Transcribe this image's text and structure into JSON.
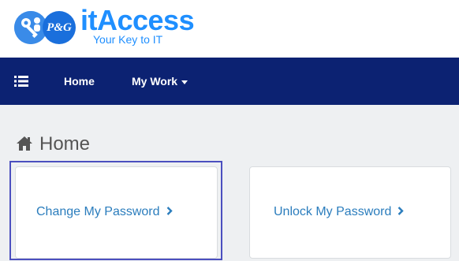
{
  "branding": {
    "title": "itAccess",
    "subtitle": "Your Key to IT",
    "pg_text": "P&G",
    "brand_color": "#1f8fff"
  },
  "navbar": {
    "background": "#0c2272",
    "menu_icon": "list-icon",
    "items": [
      {
        "label": "Home",
        "icon": null
      },
      {
        "label": "My Work",
        "icon": "caret-down-icon"
      }
    ]
  },
  "page": {
    "title": "Home",
    "title_icon": "home-icon"
  },
  "cards": [
    {
      "label": "Change My Password",
      "icon": "chevron-right-icon",
      "highlighted": true
    },
    {
      "label": "Unlock My Password",
      "icon": "chevron-right-icon",
      "highlighted": false
    }
  ],
  "colors": {
    "link": "#2b7dbd",
    "highlight_border": "#4b4fbf",
    "content_bg": "#eef0f2"
  }
}
